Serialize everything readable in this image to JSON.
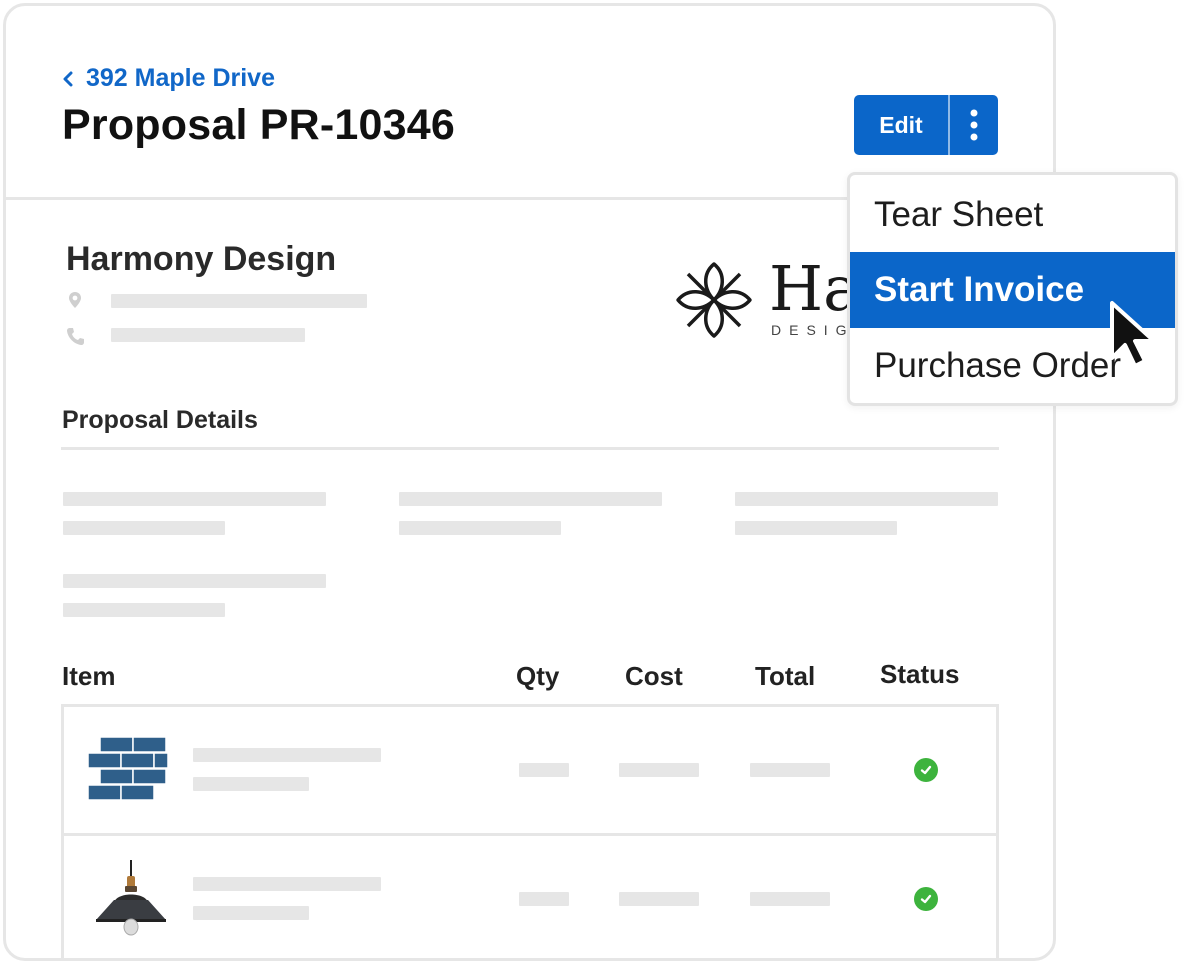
{
  "header": {
    "back_label": "392 Maple Drive",
    "title": "Proposal PR-10346",
    "edit_label": "Edit"
  },
  "company": {
    "name": "Harmony Design",
    "logo_text": "Ha",
    "logo_subtext": "DESIG"
  },
  "details": {
    "section_title": "Proposal Details"
  },
  "items_table": {
    "columns": [
      "Item",
      "Qty",
      "Cost",
      "Total",
      "Status"
    ],
    "rows": [
      {
        "thumbnail": "blue-tile-icon",
        "status": "complete"
      },
      {
        "thumbnail": "pendant-lamp-icon",
        "status": "complete"
      }
    ]
  },
  "actions_menu": {
    "items": [
      "Tear Sheet",
      "Start Invoice",
      "Purchase Order"
    ],
    "highlighted": "Start Invoice"
  },
  "colors": {
    "accent": "#0b66c9",
    "link": "#1167c8",
    "success": "#3db33d",
    "placeholder": "#e6e6e6"
  }
}
